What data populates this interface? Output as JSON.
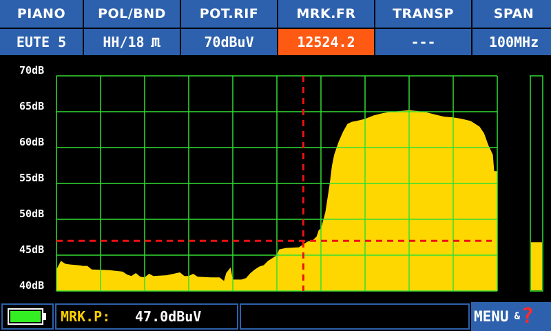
{
  "header": {
    "columns": [
      {
        "label": "PIANO",
        "value": "EUTE 5",
        "highlight": false
      },
      {
        "label": "POL/BND",
        "value": "HH/18",
        "highlight": false,
        "icon": "pulse-icon"
      },
      {
        "label": "POT.RIF",
        "value": "70dBuV",
        "highlight": false
      },
      {
        "label": "MRK.FR",
        "value": "12524.2",
        "highlight": true
      },
      {
        "label": "TRANSP",
        "value": "---",
        "highlight": false
      },
      {
        "label": "SPAN",
        "value": "100MHz",
        "highlight": false
      }
    ]
  },
  "spectrum": {
    "y_ticks": [
      "70dB",
      "65dB",
      "60dB",
      "55dB",
      "50dB",
      "45dB",
      "40dB"
    ],
    "y_min": 40,
    "y_max": 70,
    "x_divisions": 10,
    "marker_x_fraction": 0.56,
    "marker_level": 47.0,
    "level_bar_value": 46.8,
    "trace": [
      [
        0.0,
        43.0
      ],
      [
        0.01,
        44.2
      ],
      [
        0.02,
        43.8
      ],
      [
        0.03,
        43.7
      ],
      [
        0.05,
        43.6
      ],
      [
        0.06,
        43.5
      ],
      [
        0.07,
        43.5
      ],
      [
        0.08,
        43.0
      ],
      [
        0.12,
        42.9
      ],
      [
        0.15,
        42.7
      ],
      [
        0.16,
        42.3
      ],
      [
        0.17,
        42.1
      ],
      [
        0.18,
        42.5
      ],
      [
        0.19,
        42.0
      ],
      [
        0.2,
        41.9
      ],
      [
        0.21,
        42.4
      ],
      [
        0.22,
        42.1
      ],
      [
        0.25,
        42.2
      ],
      [
        0.28,
        42.6
      ],
      [
        0.29,
        42.1
      ],
      [
        0.3,
        42.1
      ],
      [
        0.31,
        42.4
      ],
      [
        0.32,
        42.0
      ],
      [
        0.35,
        41.9
      ],
      [
        0.37,
        41.9
      ],
      [
        0.38,
        41.4
      ],
      [
        0.385,
        42.5
      ],
      [
        0.395,
        43.3
      ],
      [
        0.4,
        41.6
      ],
      [
        0.42,
        41.6
      ],
      [
        0.43,
        41.8
      ],
      [
        0.44,
        42.5
      ],
      [
        0.45,
        43.0
      ],
      [
        0.46,
        43.4
      ],
      [
        0.47,
        43.6
      ],
      [
        0.48,
        44.2
      ],
      [
        0.49,
        44.6
      ],
      [
        0.5,
        45.0
      ],
      [
        0.505,
        45.8
      ],
      [
        0.52,
        46.0
      ],
      [
        0.55,
        46.1
      ],
      [
        0.56,
        46.5
      ],
      [
        0.57,
        46.9
      ],
      [
        0.58,
        47.0
      ],
      [
        0.59,
        47.6
      ],
      [
        0.595,
        48.5
      ],
      [
        0.6,
        48.7
      ],
      [
        0.61,
        51.0
      ],
      [
        0.615,
        53.0
      ],
      [
        0.62,
        55.0
      ],
      [
        0.625,
        57.5
      ],
      [
        0.63,
        59.0
      ],
      [
        0.64,
        60.8
      ],
      [
        0.65,
        62.2
      ],
      [
        0.66,
        63.3
      ],
      [
        0.67,
        63.6
      ],
      [
        0.68,
        63.7
      ],
      [
        0.7,
        64.0
      ],
      [
        0.72,
        64.5
      ],
      [
        0.74,
        64.8
      ],
      [
        0.76,
        65.0
      ],
      [
        0.8,
        65.2
      ],
      [
        0.82,
        65.1
      ],
      [
        0.84,
        64.9
      ],
      [
        0.86,
        64.6
      ],
      [
        0.88,
        64.3
      ],
      [
        0.9,
        64.2
      ],
      [
        0.92,
        64.0
      ],
      [
        0.94,
        63.7
      ],
      [
        0.96,
        62.9
      ],
      [
        0.97,
        62.0
      ],
      [
        0.98,
        60.3
      ],
      [
        0.99,
        59.0
      ],
      [
        0.993,
        56.7
      ],
      [
        1.0,
        56.7
      ]
    ]
  },
  "footer": {
    "battery_icon": "battery-icon",
    "marker_label": "MRK.P:",
    "marker_value": "47.0dBuV",
    "menu_label": "MENU",
    "menu_amp": "&",
    "help_glyph": "?"
  },
  "colors": {
    "panel_blue": "#2d61ad",
    "highlight_orange": "#ff5a14",
    "grid_green": "#33dd33",
    "trace_yellow": "#ffd700",
    "marker_red": "#ee1111",
    "battery_green": "#33ee22",
    "label_yellow": "#ffcf00"
  }
}
